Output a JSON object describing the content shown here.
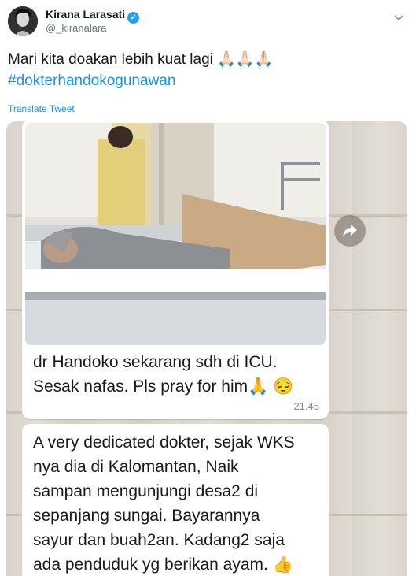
{
  "tweet": {
    "display_name": "Kirana Larasati",
    "handle": "@_kiranalara",
    "text": "Mari kita doakan lebih kuat lagi 🙏🏻🙏🏻🙏🏻",
    "hashtag": "#dokterhandokogunawan",
    "translate_label": "Translate Tweet",
    "verified_mark": "✓"
  },
  "chat": {
    "message1": {
      "line1": "dr Handoko sekarang sdh di ICU.",
      "line2": "Sesak nafas. Pls pray for him🙏 😔",
      "time": "21.45"
    },
    "message2": {
      "lines": [
        "A very dedicated dokter, sejak WKS",
        "nya dia di Kalomantan, Naik",
        "sampan mengunjungi desa2 di",
        "sepanjang sungai. Bayarannya",
        "sayur dan buah2an. Kadang2 saja",
        "ada penduduk yg berikan ayam. 👍",
        "🙏🙏"
      ]
    }
  },
  "colors": {
    "link": "#1b95e0",
    "verified": "#1da1f2",
    "text": "#14171a",
    "muted": "#657786"
  },
  "icons": [
    "verified-badge-icon",
    "chevron-down-icon",
    "share-forward-icon"
  ]
}
